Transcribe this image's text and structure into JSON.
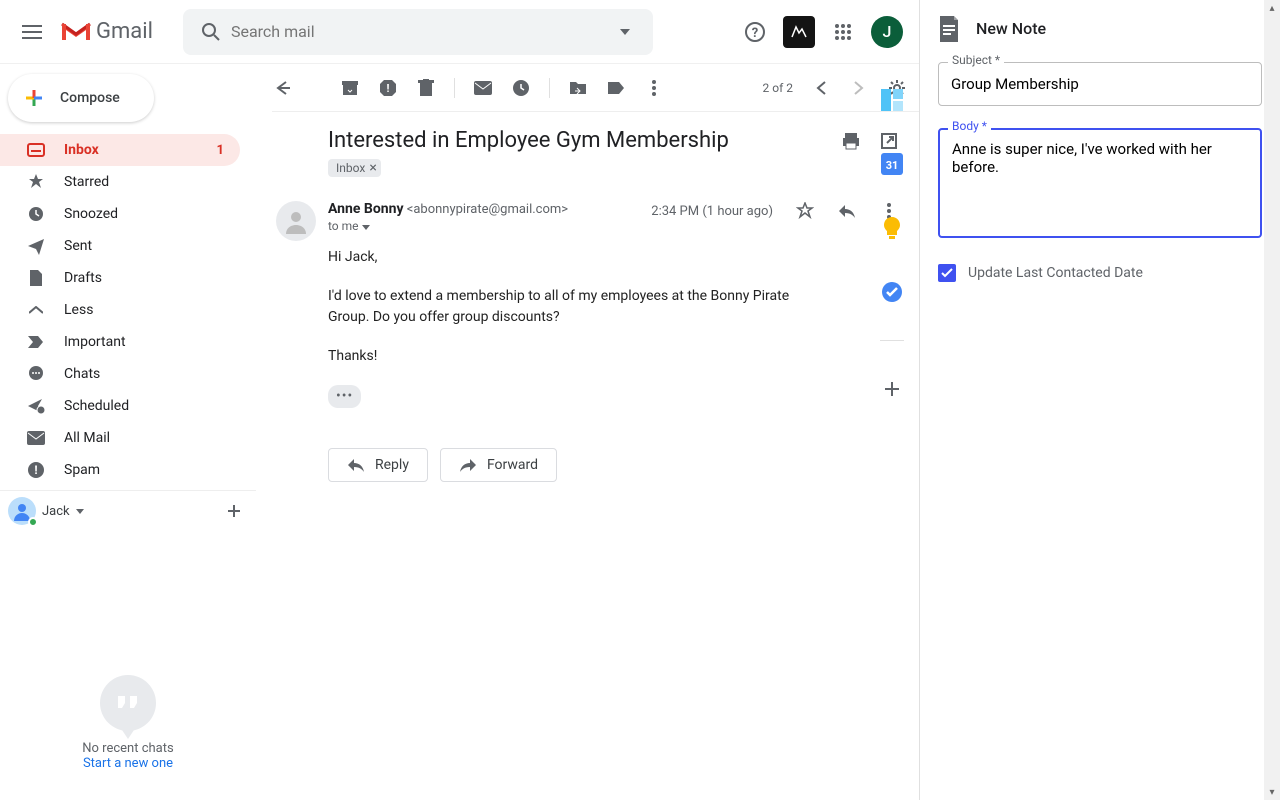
{
  "header": {
    "product_name": "Gmail",
    "search_placeholder": "Search mail",
    "avatar_initial": "J"
  },
  "compose_label": "Compose",
  "nav": {
    "inbox": "Inbox",
    "inbox_count": "1",
    "starred": "Starred",
    "snoozed": "Snoozed",
    "sent": "Sent",
    "drafts": "Drafts",
    "less": "Less",
    "important": "Important",
    "chats": "Chats",
    "scheduled": "Scheduled",
    "allmail": "All Mail",
    "spam": "Spam"
  },
  "hangouts": {
    "user": "Jack",
    "empty1": "No recent chats",
    "empty2": "Start a new one"
  },
  "toolbar": {
    "page_info": "2 of 2"
  },
  "email": {
    "subject": "Interested in Employee Gym Membership",
    "label": "Inbox",
    "sender_name": "Anne Bonny",
    "sender_email": "<abonnypirate@gmail.com>",
    "timestamp": "2:34 PM (1 hour ago)",
    "to_line": "to me",
    "body_p1": "Hi Jack,",
    "body_p2": "I'd love to extend a membership to all of my employees at the Bonny Pirate Group. Do you offer group discounts?",
    "body_p3": "Thanks!",
    "reply_label": "Reply",
    "forward_label": "Forward"
  },
  "addon": {
    "title": "New Note",
    "subject_label": "Subject *",
    "subject_value": "Group Membership",
    "body_label": "Body *",
    "body_value": "Anne is super nice, I've worked with her before.",
    "checkbox_label": "Update Last Contacted Date"
  }
}
